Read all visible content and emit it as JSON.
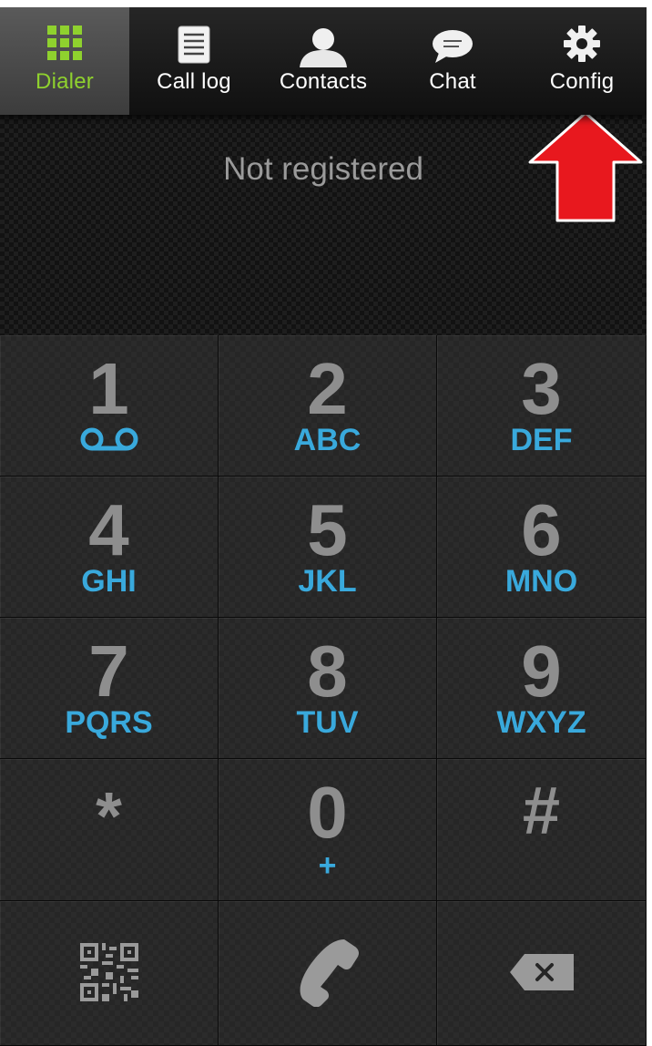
{
  "tabs": [
    {
      "label": "Dialer",
      "icon": "grid-icon",
      "active": true
    },
    {
      "label": "Call log",
      "icon": "list-icon",
      "active": false
    },
    {
      "label": "Contacts",
      "icon": "person-icon",
      "active": false
    },
    {
      "label": "Chat",
      "icon": "chat-bubble-icon",
      "active": false
    },
    {
      "label": "Config",
      "icon": "gear-icon",
      "active": false
    }
  ],
  "status": {
    "text": "Not registered"
  },
  "keypad": {
    "keys": [
      {
        "digit": "1",
        "letters": "",
        "sub_icon": "voicemail-icon"
      },
      {
        "digit": "2",
        "letters": "ABC"
      },
      {
        "digit": "3",
        "letters": "DEF"
      },
      {
        "digit": "4",
        "letters": "GHI"
      },
      {
        "digit": "5",
        "letters": "JKL"
      },
      {
        "digit": "6",
        "letters": "MNO"
      },
      {
        "digit": "7",
        "letters": "PQRS"
      },
      {
        "digit": "8",
        "letters": "TUV"
      },
      {
        "digit": "9",
        "letters": "WXYZ"
      },
      {
        "digit": "*",
        "letters": ""
      },
      {
        "digit": "0",
        "letters": "+"
      },
      {
        "digit": "#",
        "letters": ""
      }
    ],
    "actions": [
      {
        "icon": "qr-code-icon"
      },
      {
        "icon": "phone-call-icon"
      },
      {
        "icon": "backspace-icon"
      }
    ]
  },
  "colors": {
    "accent_green": "#8fd12e",
    "letters_blue": "#39a9dc",
    "arrow_red": "#e8181e",
    "digit_gray": "#8e8e8e"
  }
}
